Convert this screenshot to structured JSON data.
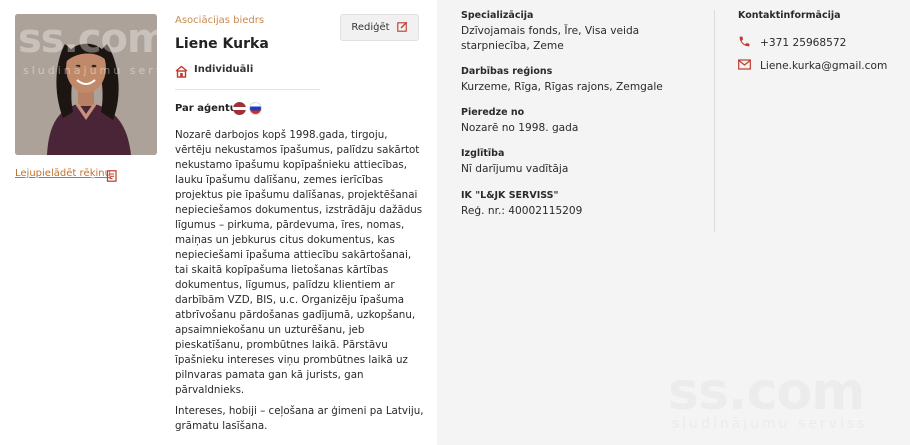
{
  "profile": {
    "member_label": "Asociācijas biedrs",
    "name": "Liene Kurka",
    "type": "Individuāli",
    "edit_button": "Rediģēt",
    "download_invoice": "Lejupielādēt rēķinu",
    "about_label": "Par aģentu",
    "languages": [
      "lv",
      "ru"
    ],
    "photo_watermark": "ss.com",
    "photo_watermark_sub": "sludinājumu serviss"
  },
  "description": [
    "Nozarē darbojos kopš 1998.gada, tirgoju, vērtēju nekustamos īpašumus, palīdzu sakārtot nekustamo īpašumu kopīpašnieku attiecības, lauku īpašumu dalīšanu, zemes ierīcības projektus pie īpašumu dalīšanas, projektēšanai nepieciešamos dokumentus, izstrādāju dažādus līgumus – pirkuma, pārdevuma, īres, nomas, maiņas un jebkurus citus dokumentus, kas nepieciešami īpašuma attiecību sakārtošanai, tai skaitā kopīpašuma lietošanas kārtības dokumentus, līgumus, palīdzu klientiem ar darbībām VZD, BIS, u.c. Organizēju īpašuma atbrīvošanu pārdošanas gadījumā, uzkopšanu, apsaimniekošanu un uzturēšanu, jeb pieskatīšanu, prombūtnes laikā. Pārstāvu īpašnieku intereses viņu prombūtnes laikā uz pilnvaras pamata gan kā jurists, gan pārvaldnieks.",
    "Intereses, hobiji – ceļošana ar ģimeni pa Latviju, grāmatu lasīšana."
  ],
  "info": {
    "specialization_label": "Specializācija",
    "specialization_value": "Dzīvojamais fonds, Īre, Visa veida starpniecība, Zeme",
    "region_label": "Darbības reģions",
    "region_value": "Kurzeme, Rīga, Rīgas rajons, Zemgale",
    "experience_label": "Pieredze no",
    "experience_value": "Nozarē no 1998. gada",
    "education_label": "Izglītība",
    "education_value": "Nī darījumu vadītāja",
    "company_label": "IK \"L&JK SERVISS\"",
    "company_value": "Reģ. nr.: 40002115209"
  },
  "contact": {
    "title": "Kontaktinformācija",
    "phone": "+371 25968572",
    "email": "Liene.kurka@gmail.com"
  },
  "watermark": {
    "title": "ss.com",
    "subtitle": "sludinājumu serviss"
  },
  "colors": {
    "accent": "#c98a4e",
    "link": "#c0722f",
    "icon_red": "#c0392b"
  }
}
